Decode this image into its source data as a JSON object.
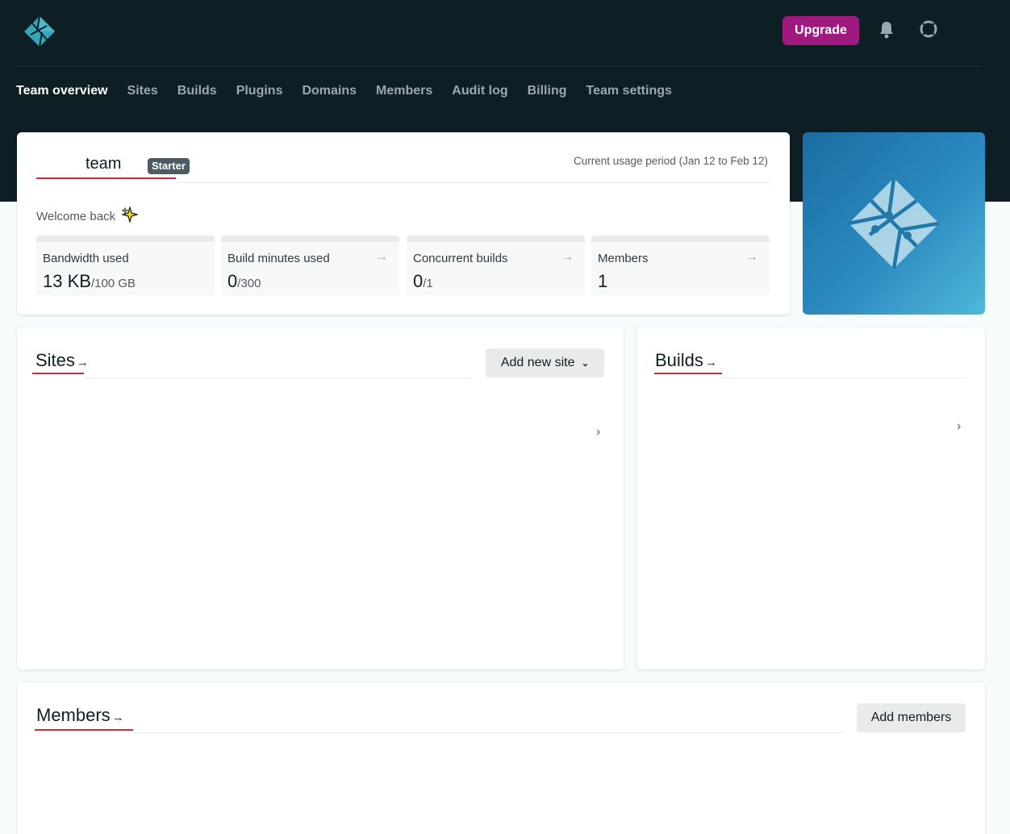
{
  "header": {
    "upgrade_label": "Upgrade",
    "brand_color": "#0e1e25",
    "upgrade_color": "#9e1a7f",
    "icons": [
      "netlify-logo-icon",
      "bell-icon",
      "help-icon"
    ]
  },
  "nav": {
    "items": [
      {
        "label": "Team overview",
        "active": true
      },
      {
        "label": "Sites"
      },
      {
        "label": "Builds"
      },
      {
        "label": "Plugins"
      },
      {
        "label": "Domains"
      },
      {
        "label": "Members"
      },
      {
        "label": "Audit log"
      },
      {
        "label": "Billing"
      },
      {
        "label": "Team settings"
      }
    ]
  },
  "overview": {
    "team_name": "team",
    "plan_badge": "Starter",
    "usage_period": "Current usage period (Jan 12 to Feb 12)",
    "welcome": "Welcome back",
    "stats": [
      {
        "label": "Bandwidth used",
        "value": "13 KB",
        "unit": "/100 GB",
        "has_arrow": false
      },
      {
        "label": "Build minutes used",
        "value": "0",
        "unit": "/300",
        "has_arrow": true
      },
      {
        "label": "Concurrent builds",
        "value": "0",
        "unit": "/1",
        "has_arrow": true
      },
      {
        "label": "Members",
        "value": "1",
        "unit": "",
        "has_arrow": true
      }
    ],
    "arrow_glyph": "→"
  },
  "sites": {
    "title": "Sites",
    "title_arrow": "→",
    "add_button": "Add new site",
    "chevron": "›"
  },
  "builds": {
    "title": "Builds",
    "title_arrow": "→",
    "chevron": "›"
  },
  "members": {
    "title": "Members",
    "title_arrow": "→",
    "add_button": "Add members"
  }
}
